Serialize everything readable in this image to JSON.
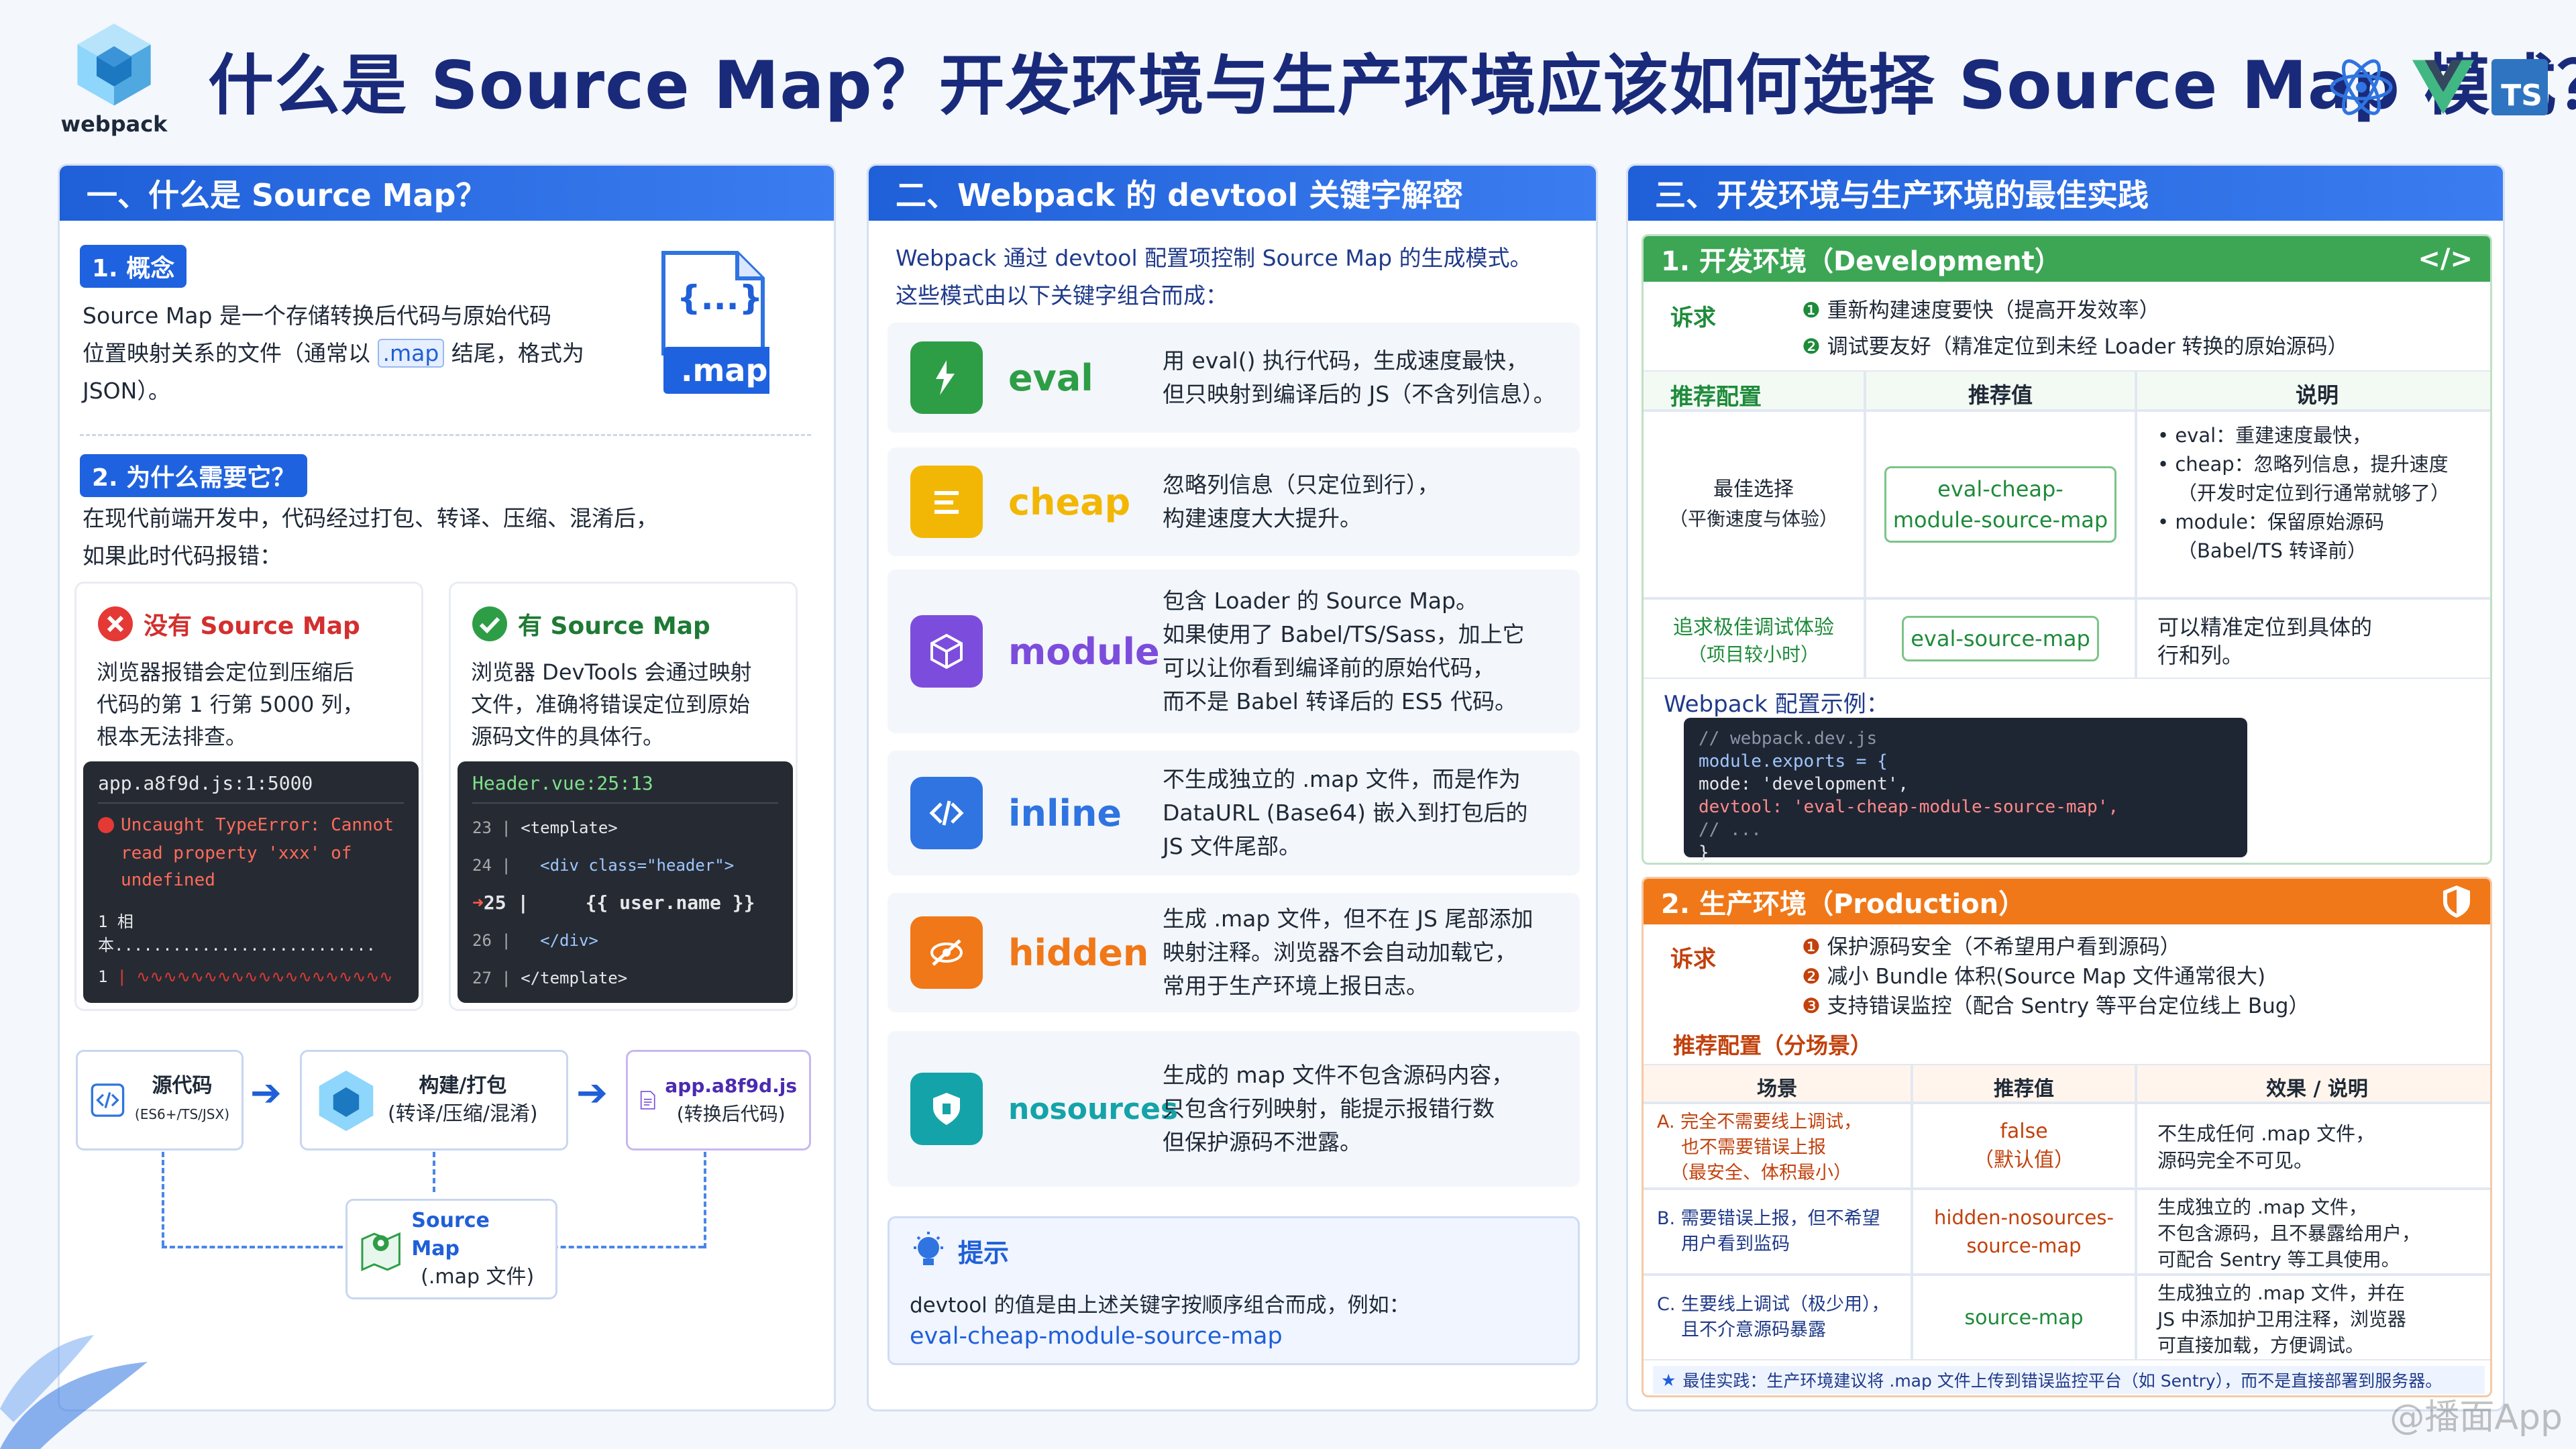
{
  "logo_text": "webpack",
  "title": "什么是 Source Map？开发环境与生产环境应该如何选择 Source Map 模式？",
  "tech_icons": [
    "react-icon",
    "vue-icon",
    "ts-icon"
  ],
  "ts_label": "TS",
  "p1": {
    "header": "一、什么是 Source Map？",
    "tag1": "1. 概念",
    "concept_a": "Source Map 是一个存储转换后代码与原始代码",
    "concept_b1": "位置映射关系的文件（通常以",
    "concept_chip": ".map",
    "concept_b2": "结尾，格式为",
    "concept_c": "JSON）。",
    "doc_braces": "{...}",
    "doc_ext": ".map",
    "tag2": "2. 为什么需要它？",
    "why_a": "在现代前端开发中，代码经过打包、转译、压缩、混淆后，",
    "why_b": "如果此时代码报错：",
    "bad": {
      "title": "没有 Source Map",
      "d1": "浏览器报错会定位到压缩后",
      "d2": "代码的第 1 行第 5000 列，",
      "d3": "根本无法排查。",
      "code_file": "app.a8f9d.js:1:5000",
      "err1": "Uncaught TypeError: Cannot",
      "err2": "read property 'xxx' of undefined",
      "l1_no": "1",
      "l1_txt": "相本...........................",
      "l2_no": "1"
    },
    "good": {
      "title": "有 Source Map",
      "d1": "浏览器 DevTools 会通过映射",
      "d2": "文件，准确将错误定位到原始",
      "d3": "源码文件的具体行。",
      "code_file": "Header.vue:25:13",
      "lines": [
        {
          "no": "23",
          "txt": "<template>"
        },
        {
          "no": "24",
          "txt": "<div class=\"header\">"
        },
        {
          "no": "25",
          "txt": "{{ user.name }}"
        },
        {
          "no": "26",
          "txt": "</div>"
        },
        {
          "no": "27",
          "txt": "</template>"
        }
      ]
    },
    "flow": {
      "src_t": "源代码",
      "src_s": "(ES6+/TS/JSX)",
      "build_t": "构建/打包",
      "build_s": "(转译/压缩/混淆)",
      "out_t": "app.a8f9d.js",
      "out_s": "(转换后代码)",
      "map_t": "Source Map",
      "map_s": "(.map 文件)"
    }
  },
  "p2": {
    "header": "二、Webpack 的 devtool 关键字解密",
    "intro1": "Webpack 通过 devtool 配置项控制 Source Map 的生成模式。",
    "intro2": "这些模式由以下关键字组合而成：",
    "keywords": [
      {
        "name": "eval",
        "d1": "用 eval() 执行代码，生成速度最快，",
        "d2": "但只映射到编译后的 JS（不含列信息）。",
        "d3": "",
        "d4": "",
        "color": "#2e9e46",
        "icon": "bolt-icon"
      },
      {
        "name": "cheap",
        "d1": "忽略列信息（只定位到行），",
        "d2": "构建速度大大提升。",
        "d3": "",
        "d4": "",
        "color": "#f2b705",
        "icon": "lines-icon"
      },
      {
        "name": "module",
        "d1": "包含 Loader 的 Source Map。",
        "d2": "如果使用了 Babel/TS/Sass，加上它",
        "d3": "可以让你看到编译前的原始代码，",
        "d4": "而不是 Babel 转译后的 ES5 代码。",
        "color": "#7c4ddc",
        "icon": "cube-icon"
      },
      {
        "name": "inline",
        "d1": "不生成独立的 .map 文件，而是作为",
        "d2": "DataURL (Base64) 嵌入到打包后的",
        "d3": "JS 文件尾部。",
        "d4": "",
        "color": "#2f74e0",
        "icon": "code-icon"
      },
      {
        "name": "hidden",
        "d1": "生成 .map 文件，但不在 JS 尾部添加",
        "d2": "映射注释。浏览器不会自动加载它，",
        "d3": "常用于生产环境上报日志。",
        "d4": "",
        "color": "#f07818",
        "icon": "eye-off-icon"
      },
      {
        "name": "nosources",
        "d1": "生成的 map 文件不包含源码内容，",
        "d2": "只包含行列映射，能提示报错行数",
        "d3": "但保护源码不泄露。",
        "d4": "",
        "color": "#14a3a8",
        "icon": "shield-icon"
      }
    ],
    "tip_title": "提示",
    "tip_text": "devtool 的值是由上述关键字按顺序组合而成，例如：",
    "tip_example": "eval-cheap-module-source-map"
  },
  "p3": {
    "header": "三、开发环境与生产环境的最佳实践",
    "dev": {
      "title": "1. 开发环境（Development）",
      "demand_lbl": "诉求",
      "demand1": "重新构建速度要快（提高开发效率）",
      "demand2": "调试要友好（精准定位到未经 Loader 转换的原始源码）",
      "col1": "推荐配置",
      "col2": "推荐值",
      "col3": "说明",
      "row1_lbl1": "最佳选择",
      "row1_lbl2": "（平衡速度与体验）",
      "row1_val1": "eval-cheap-",
      "row1_val2": "module-source-map",
      "row1_notes": [
        "eval：重建速度最快，",
        "cheap：忽略列信息，提升速度",
        "（开发时定位到行通常就够了）",
        "module：保留原始源码",
        "（Babel/TS 转译前）"
      ],
      "row2_lbl1": "追求极佳调试体验",
      "row2_lbl2": "（项目较小时）",
      "row2_val": "eval-source-map",
      "row2_n1": "可以精准定位到具体的",
      "row2_n2": "行和列。",
      "example_title": "Webpack 配置示例：",
      "code": [
        "// webpack.dev.js",
        "module.exports = {",
        "  mode: 'development',",
        "  devtool: 'eval-cheap-module-source-map',",
        "  // ...",
        "}"
      ]
    },
    "prod": {
      "title": "2. 生产环境（Production）",
      "demand_lbl": "诉求",
      "demand1": "保护源码安全（不希望用户看到源码）",
      "demand2": "减小 Bundle 体积(Source Map 文件通常很大)",
      "demand3": "支持错误监控（配合 Sentry 等平台定位线上 Bug）",
      "sub": "推荐配置（分场景）",
      "col1": "场景",
      "col2": "推荐值",
      "col3": "效果 / 说明",
      "rows": [
        {
          "s1": "A. 完全不需要线上调试，",
          "s2": "也不需要错误上报",
          "s3": "（最安全、体积最小）",
          "v1": "false",
          "v2": "（默认值）",
          "e1": "不生成任何 .map 文件，",
          "e2": "源码完全不可见。",
          "e3": ""
        },
        {
          "s1": "B. 需要错误上报，但不希望",
          "s2": "用户看到监码",
          "s3": "",
          "v1": "hidden-nosources-",
          "v2": "source-map",
          "e1": "生成独立的 .map 文件，",
          "e2": "不包含源码，且不暴露给用户，",
          "e3": "可配合 Sentry 等工具使用。"
        },
        {
          "s1": "C. 生要线上调试（极少用），",
          "s2": "且不介意源码暴露",
          "s3": "",
          "v1": "source-map",
          "v2": "",
          "e1": "生成独立的 .map 文件，并在",
          "e2": "JS 中添加护卫用注释，浏览器",
          "e3": "可直接加载，方便调试。"
        }
      ],
      "footer": "最佳实践：生产环境建议将 .map 文件上传到错误监控平台（如 Sentry），而不是直接部署到服务器。"
    }
  },
  "watermark": "@播面App"
}
